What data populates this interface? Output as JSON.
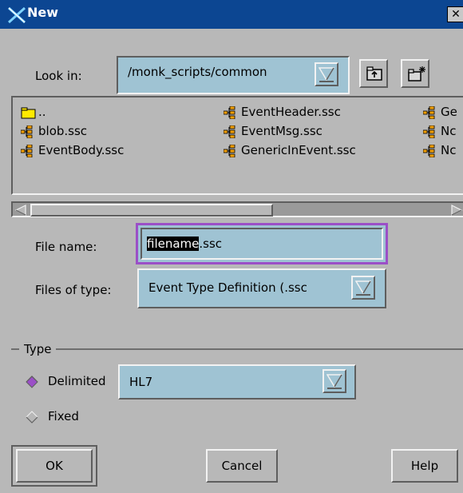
{
  "window": {
    "title": "New",
    "close_glyph": "✕"
  },
  "look_in": {
    "label": "Look in:",
    "value": "/monk_scripts/common"
  },
  "toolbar": {
    "up_icon": "folder-up-icon",
    "new_icon": "new-folder-icon"
  },
  "files": [
    {
      "name": "..",
      "icon": "folder-icon"
    },
    {
      "name": "blob.ssc",
      "icon": "file-ssc-icon"
    },
    {
      "name": "EventBody.ssc",
      "icon": "file-ssc-icon"
    },
    {
      "name": "EventHeader.ssc",
      "icon": "file-ssc-icon"
    },
    {
      "name": "EventMsg.ssc",
      "icon": "file-ssc-icon"
    },
    {
      "name": "GenericInEvent.ssc",
      "icon": "file-ssc-icon"
    },
    {
      "name": "Ge",
      "icon": "file-ssc-icon"
    },
    {
      "name": "Nc",
      "icon": "file-ssc-icon"
    },
    {
      "name": "Nc",
      "icon": "file-ssc-icon"
    }
  ],
  "file_name": {
    "label": "File name:",
    "selected": "filename",
    "rest": ".ssc"
  },
  "files_of_type": {
    "label": "Files of type:",
    "value": "Event Type Definition (.ssc"
  },
  "type_group": {
    "label": "Type",
    "delimited_label": "Delimited",
    "fixed_label": "Fixed",
    "selected": "Delimited",
    "format_value": "HL7"
  },
  "buttons": {
    "ok": "OK",
    "cancel": "Cancel",
    "help": "Help"
  },
  "colors": {
    "title_bar": "#0c4692",
    "field": "#9fc3d3",
    "focus": "#9b4fc7",
    "radio_on": "#9b4fc7"
  }
}
